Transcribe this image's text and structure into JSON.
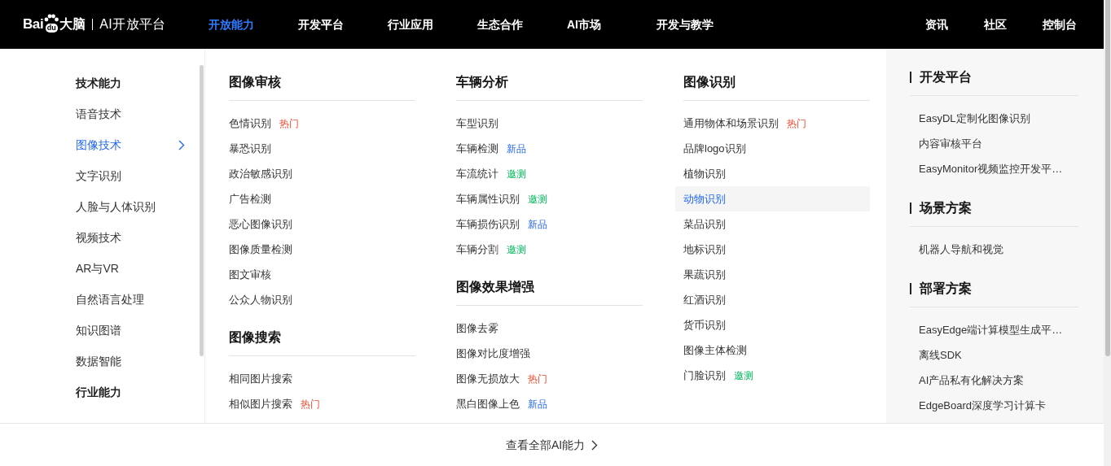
{
  "header": {
    "logo": {
      "brand": "Bai",
      "paw_text": "du",
      "brand_tail": "大脑",
      "product": "AI开放平台"
    },
    "nav": [
      {
        "label": "开放能力",
        "selected": true
      },
      {
        "label": "开发平台",
        "selected": false
      },
      {
        "label": "行业应用",
        "selected": false
      },
      {
        "label": "生态合作",
        "selected": false
      },
      {
        "label": "AI市场",
        "selected": false
      },
      {
        "label": "开发与教学",
        "selected": false
      }
    ],
    "right_nav": [
      "资讯",
      "社区",
      "控制台"
    ]
  },
  "sidebar": {
    "items": [
      {
        "label": "技术能力",
        "kind": "heading"
      },
      {
        "label": "语音技术",
        "kind": "link",
        "selected": false
      },
      {
        "label": "图像技术",
        "kind": "link",
        "selected": true
      },
      {
        "label": "文字识别",
        "kind": "link",
        "selected": false
      },
      {
        "label": "人脸与人体识别",
        "kind": "link",
        "selected": false
      },
      {
        "label": "视频技术",
        "kind": "link",
        "selected": false
      },
      {
        "label": "AR与VR",
        "kind": "link",
        "selected": false
      },
      {
        "label": "自然语言处理",
        "kind": "link",
        "selected": false
      },
      {
        "label": "知识图谱",
        "kind": "link",
        "selected": false
      },
      {
        "label": "数据智能",
        "kind": "link",
        "selected": false
      },
      {
        "label": "行业能力",
        "kind": "heading"
      }
    ]
  },
  "columns": [
    {
      "sections": [
        {
          "title": "图像审核",
          "items": [
            {
              "label": "色情识别",
              "badge": {
                "text": "热门",
                "kind": "hot"
              },
              "highlighted": false
            },
            {
              "label": "暴恐识别",
              "highlighted": false
            },
            {
              "label": "政治敏感识别",
              "highlighted": false
            },
            {
              "label": "广告检测",
              "highlighted": false
            },
            {
              "label": "恶心图像识别",
              "highlighted": false
            },
            {
              "label": "图像质量检测",
              "highlighted": false
            },
            {
              "label": "图文审核",
              "highlighted": false
            },
            {
              "label": "公众人物识别",
              "highlighted": false
            }
          ]
        },
        {
          "title": "图像搜索",
          "items": [
            {
              "label": "相同图片搜索",
              "highlighted": false
            },
            {
              "label": "相似图片搜索",
              "badge": {
                "text": "热门",
                "kind": "hot"
              },
              "highlighted": false
            }
          ]
        }
      ]
    },
    {
      "sections": [
        {
          "title": "车辆分析",
          "items": [
            {
              "label": "车型识别",
              "highlighted": false
            },
            {
              "label": "车辆检测",
              "badge": {
                "text": "新品",
                "kind": "new"
              },
              "highlighted": false
            },
            {
              "label": "车流统计",
              "badge": {
                "text": "邀测",
                "kind": "invite"
              },
              "highlighted": false
            },
            {
              "label": "车辆属性识别",
              "badge": {
                "text": "邀测",
                "kind": "invite"
              },
              "highlighted": false
            },
            {
              "label": "车辆损伤识别",
              "badge": {
                "text": "新品",
                "kind": "new"
              },
              "highlighted": false
            },
            {
              "label": "车辆分割",
              "badge": {
                "text": "邀测",
                "kind": "invite"
              },
              "highlighted": false
            }
          ]
        },
        {
          "title": "图像效果增强",
          "items": [
            {
              "label": "图像去雾",
              "highlighted": false
            },
            {
              "label": "图像对比度增强",
              "highlighted": false
            },
            {
              "label": "图像无损放大",
              "badge": {
                "text": "热门",
                "kind": "hot"
              },
              "highlighted": false
            },
            {
              "label": "黑白图像上色",
              "badge": {
                "text": "新品",
                "kind": "new"
              },
              "highlighted": false
            }
          ]
        }
      ]
    },
    {
      "sections": [
        {
          "title": "图像识别",
          "items": [
            {
              "label": "通用物体和场景识别",
              "badge": {
                "text": "热门",
                "kind": "hot"
              },
              "highlighted": false
            },
            {
              "label": "品牌logo识别",
              "highlighted": false
            },
            {
              "label": "植物识别",
              "highlighted": false
            },
            {
              "label": "动物识别",
              "highlighted": true
            },
            {
              "label": "菜品识别",
              "highlighted": false
            },
            {
              "label": "地标识别",
              "highlighted": false
            },
            {
              "label": "果蔬识别",
              "highlighted": false
            },
            {
              "label": "红酒识别",
              "highlighted": false
            },
            {
              "label": "货币识别",
              "highlighted": false
            },
            {
              "label": "图像主体检测",
              "highlighted": false
            },
            {
              "label": "门脸识别",
              "badge": {
                "text": "邀测",
                "kind": "invite"
              },
              "highlighted": false
            }
          ]
        }
      ]
    }
  ],
  "side_panel": {
    "sections": [
      {
        "title": "开发平台",
        "items": [
          "EasyDL定制化图像识别",
          "内容审核平台",
          "EasyMonitor视频监控开发平…"
        ]
      },
      {
        "title": "场景方案",
        "items": [
          "机器人导航和视觉"
        ]
      },
      {
        "title": "部署方案",
        "items": [
          "EasyEdge端计算模型生成平…",
          "离线SDK",
          "AI产品私有化解决方案",
          "EdgeBoard深度学习计算卡"
        ]
      }
    ]
  },
  "footer": {
    "link": "查看全部AI能力"
  }
}
